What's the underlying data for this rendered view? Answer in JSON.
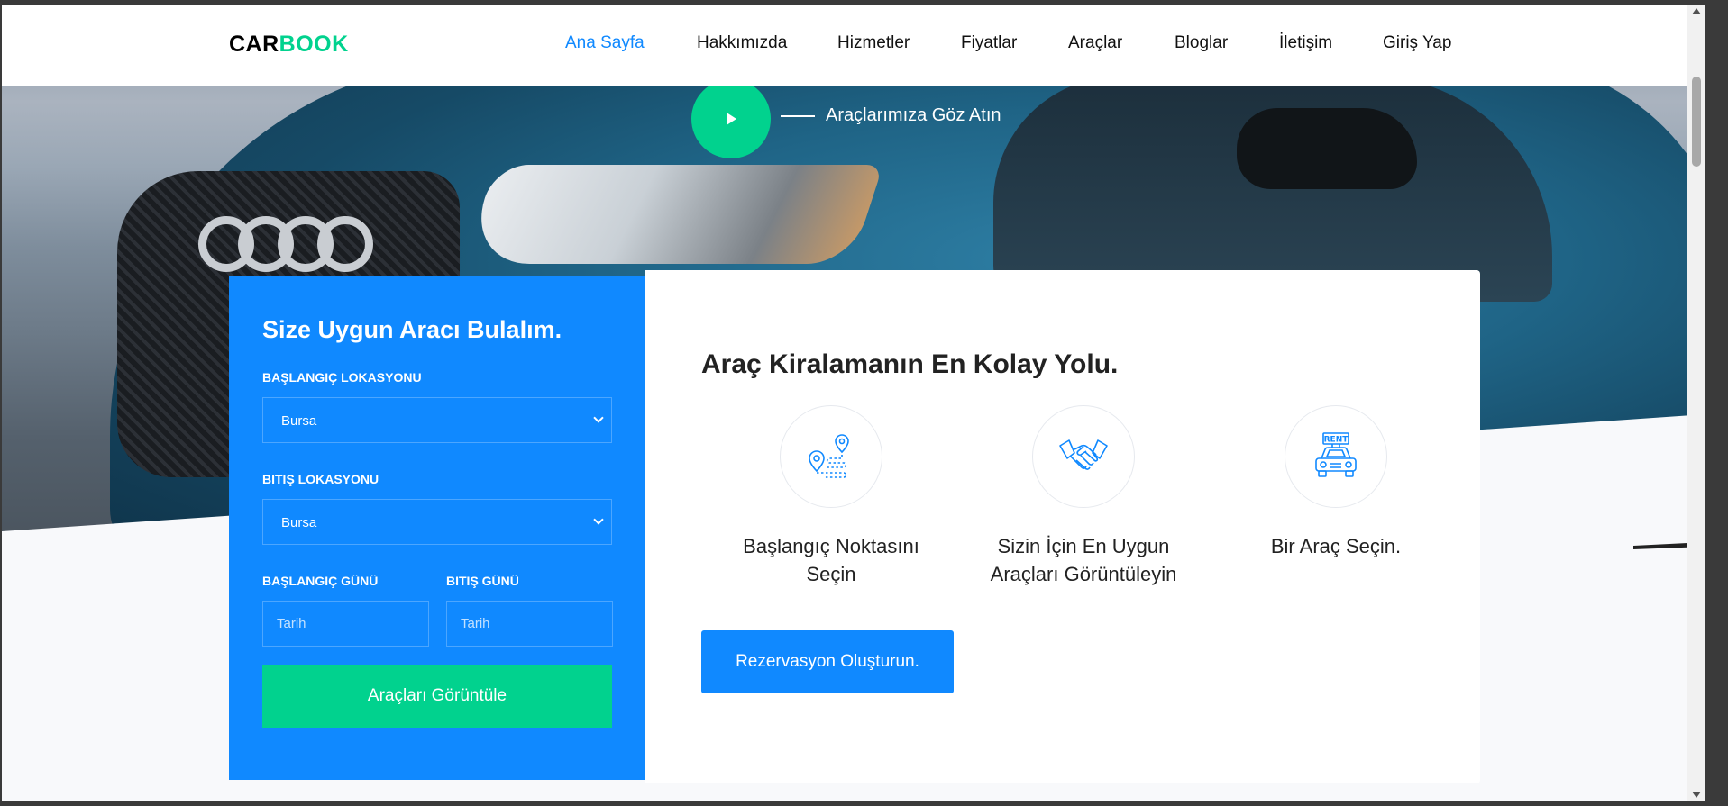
{
  "brand": {
    "part1": "CAR",
    "part2": "BOOK"
  },
  "nav": {
    "items": [
      {
        "label": "Ana Sayfa",
        "active": true
      },
      {
        "label": "Hakkımızda"
      },
      {
        "label": "Hizmetler"
      },
      {
        "label": "Fiyatlar"
      },
      {
        "label": "Araçlar"
      },
      {
        "label": "Bloglar"
      },
      {
        "label": "İletişim"
      },
      {
        "label": "Giriş Yap"
      }
    ]
  },
  "hero": {
    "video_label": "Araçlarımıza Göz Atın"
  },
  "search": {
    "title": "Size Uygun Aracı Bulalım.",
    "start_location_label": "BAŞLANGIÇ LOKASYONU",
    "start_location_value": "Bursa",
    "end_location_label": "BITIŞ LOKASYONU",
    "end_location_value": "Bursa",
    "start_date_label": "BAŞLANGIÇ GÜNÜ",
    "end_date_label": "BITIŞ GÜNÜ",
    "start_date_placeholder": "Tarih",
    "end_date_placeholder": "Tarih",
    "submit_label": "Araçları Görüntüle"
  },
  "info": {
    "title": "Araç Kiralamanın En Kolay Yolu.",
    "steps": [
      {
        "icon": "route-pin-icon",
        "line1": "Başlangıç Noktasını",
        "line2": "Seçin"
      },
      {
        "icon": "handshake-icon",
        "line1": "Sizin İçin En Uygun",
        "line2": "Araçları Görüntüleyin"
      },
      {
        "icon": "rent-car-icon",
        "line1": "Bir Araç Seçin.",
        "line2": "",
        "badge": "RENT"
      }
    ],
    "cta_label": "Rezervasyon Oluşturun."
  },
  "colors": {
    "primary": "#1089ff",
    "accent": "#01d28e"
  }
}
